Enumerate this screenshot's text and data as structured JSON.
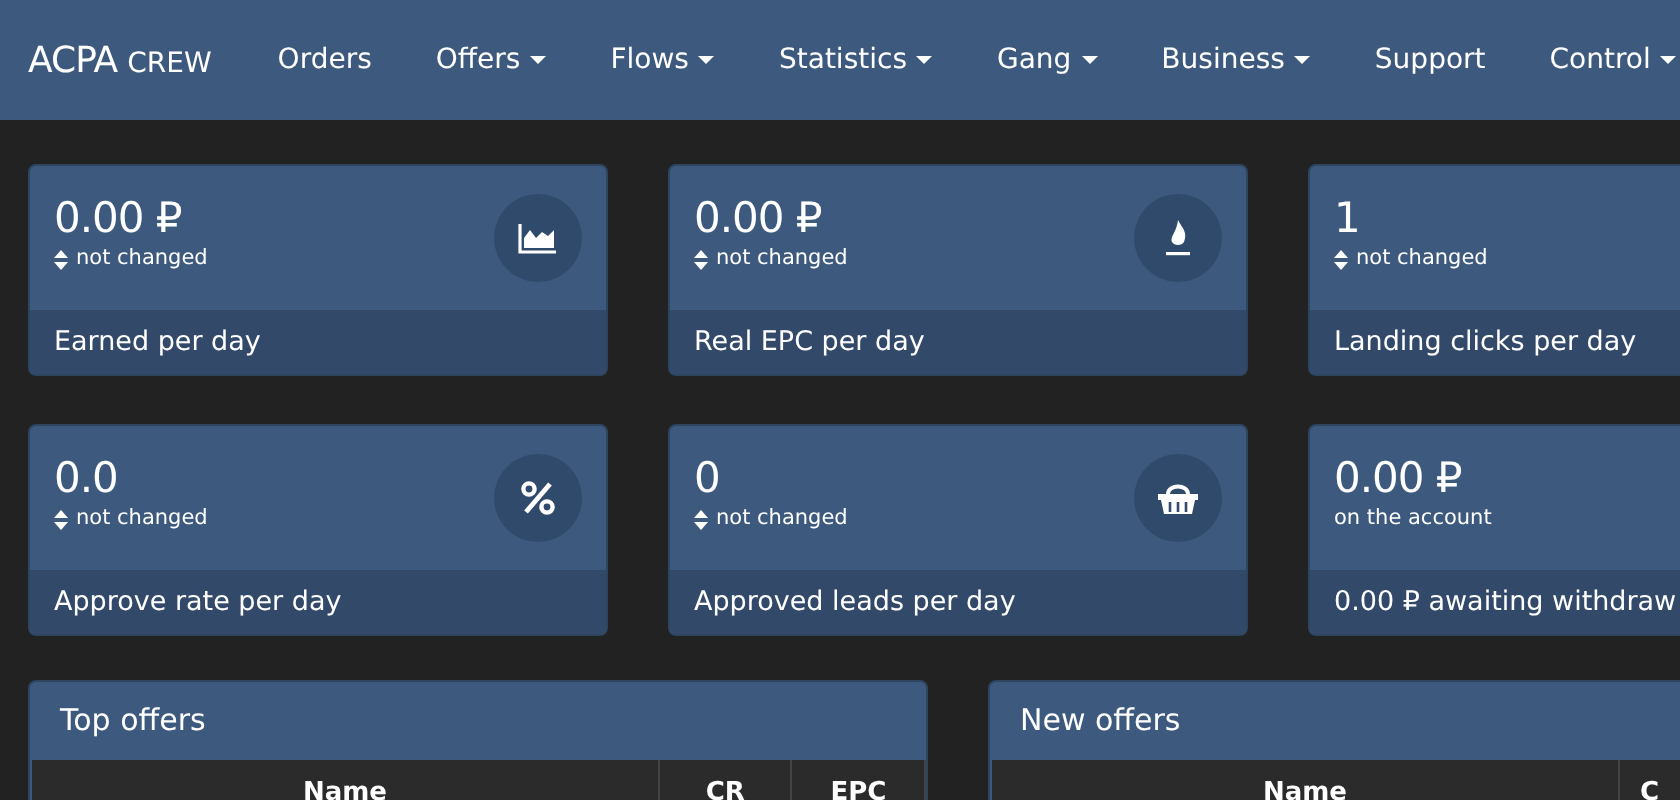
{
  "brand": {
    "main": "ACPA",
    "sub": "CREW"
  },
  "nav": [
    {
      "label": "Orders",
      "dropdown": false
    },
    {
      "label": "Offers",
      "dropdown": true
    },
    {
      "label": "Flows",
      "dropdown": true
    },
    {
      "label": "Statistics",
      "dropdown": true
    },
    {
      "label": "Gang",
      "dropdown": true
    },
    {
      "label": "Business",
      "dropdown": true
    },
    {
      "label": "Support",
      "dropdown": false
    },
    {
      "label": "Control",
      "dropdown": true
    }
  ],
  "stats": [
    {
      "value": "0.00 ₽",
      "note": "not changed",
      "trend": true,
      "label": "Earned per day"
    },
    {
      "value": "0.00 ₽",
      "note": "not changed",
      "trend": true,
      "label": "Real EPC per day"
    },
    {
      "value": "1",
      "note": "not changed",
      "trend": true,
      "label": "Landing clicks per day"
    },
    {
      "value": "0.0",
      "note": "not changed",
      "trend": true,
      "label": "Approve rate per day"
    },
    {
      "value": "0",
      "note": "not changed",
      "trend": true,
      "label": "Approved leads per day"
    },
    {
      "value": "0.00 ₽",
      "note": "on the account",
      "trend": false,
      "label": "0.00 ₽ awaiting withdraw"
    }
  ],
  "panels": [
    {
      "title": "Top offers",
      "columns": [
        "Name",
        "CR",
        "EPC"
      ]
    },
    {
      "title": "New offers",
      "columns": [
        "Name",
        "C"
      ]
    }
  ]
}
